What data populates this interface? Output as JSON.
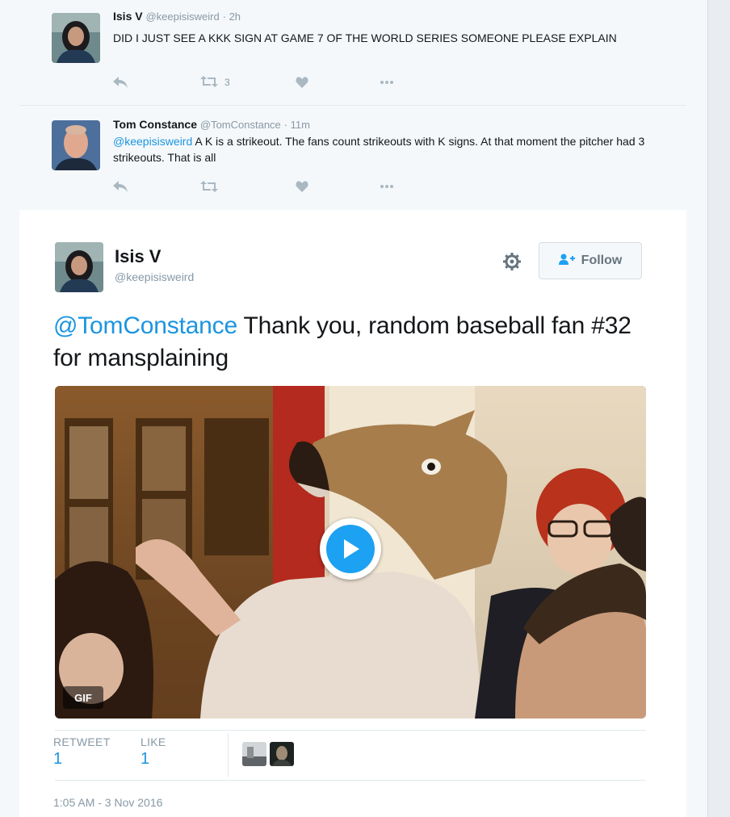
{
  "replies": [
    {
      "name": "Isis V",
      "handle": "@keepisisweird",
      "time": "2h",
      "text": "DID I JUST SEE A KKK SIGN AT GAME 7 OF THE WORLD SERIES SOMEONE PLEASE EXPLAIN",
      "retweet_count": "3",
      "actions": [
        "reply-icon",
        "retweet-icon",
        "like-icon",
        "more-icon"
      ]
    },
    {
      "name": "Tom Constance",
      "handle": "@TomConstance",
      "time": "11m",
      "mention": "@keepisisweird",
      "text": " A K is a strikeout. The fans count strikeouts with K signs. At that moment the pitcher had 3 strikeouts. That is all",
      "retweet_count": "",
      "actions": [
        "reply-icon",
        "retweet-icon",
        "like-icon",
        "more-icon"
      ]
    }
  ],
  "main_tweet": {
    "name": "Isis V",
    "handle": "@keepisisweird",
    "follow_label": "Follow",
    "mention": "@TomConstance",
    "text": " Thank you, random baseball fan #32 for mansplaining",
    "media_badge": "GIF",
    "retweet_label": "RETWEET",
    "retweet_value": "1",
    "like_label": "LIKE",
    "like_value": "1",
    "timestamp": "1:05 AM - 3 Nov 2016"
  },
  "colors": {
    "link": "#1b95e0",
    "muted": "#8899a6",
    "play_button": "#1da1f2"
  }
}
